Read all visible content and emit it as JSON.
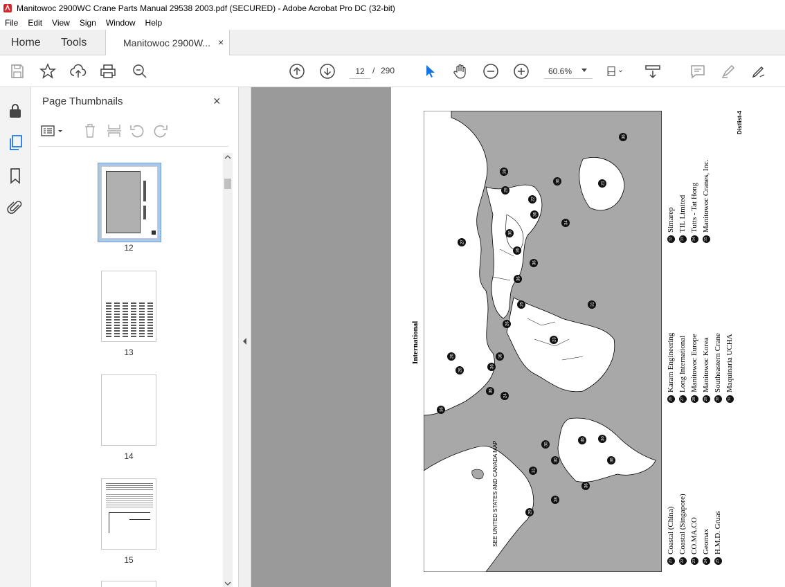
{
  "window": {
    "title": "Manitowoc 2900WC Crane Parts Manual 29538 2003.pdf (SECURED) - Adobe Acrobat Pro DC (32-bit)"
  },
  "menu": [
    "File",
    "Edit",
    "View",
    "Sign",
    "Window",
    "Help"
  ],
  "tabs": {
    "home": "Home",
    "tools": "Tools",
    "doc": "Manitowoc 2900W...",
    "close": "×"
  },
  "toolbar": {
    "page_current": "12",
    "page_sep": "/",
    "page_total": "290",
    "zoom": "60.6%",
    "icons": [
      "save-icon",
      "star-icon",
      "upload-icon",
      "print-icon",
      "search-zoom-icon",
      "prev-page-icon",
      "next-page-icon",
      "select-arrow-icon",
      "hand-icon",
      "zoom-out-icon",
      "zoom-in-icon",
      "fit-page-icon",
      "scroll-mode-icon",
      "comment-icon",
      "highlight-icon",
      "sign-icon"
    ]
  },
  "thumbnails_panel": {
    "title": "Page Thumbnails",
    "close": "×",
    "pages": [
      "12",
      "13",
      "14",
      "15"
    ],
    "selected": "12"
  },
  "document": {
    "heading": "International",
    "corner_label": "Distlist-4",
    "map_note": "SEE UNITED STATES AND CANADA MAP",
    "dealers_col1": [
      {
        "num": "21",
        "name": "Coastal (China)"
      },
      {
        "num": "22",
        "name": "Coastal (Singapore)"
      },
      {
        "num": "23",
        "name": "CO.MA.CO"
      },
      {
        "num": "24",
        "name": "Geomax"
      },
      {
        "num": "25",
        "name": "H.M.D. Gruas"
      }
    ],
    "dealers_col2": [
      {
        "num": "26",
        "name": "Karam Engineering"
      },
      {
        "num": "27",
        "name": "Long International"
      },
      {
        "num": "28",
        "name": "Manitowoc Europe"
      },
      {
        "num": "29",
        "name": "Manitowoc Korea"
      },
      {
        "num": "30",
        "name": "Southeastern Crane"
      },
      {
        "num": "31",
        "name": "Maquinaria UCHA"
      }
    ],
    "dealers_col3": [
      {
        "num": "32",
        "name": "Simarep"
      },
      {
        "num": "33",
        "name": "TIL Limited"
      },
      {
        "num": "34",
        "name": "Tutts - Tat Hong"
      },
      {
        "num": "35",
        "name": "Manitowoc Cranes, Inc."
      }
    ],
    "map_markers": [
      "36",
      "38",
      "29",
      "22",
      "36",
      "21",
      "36",
      "34",
      "36",
      "27",
      "36",
      "36",
      "36",
      "25",
      "31",
      "26",
      "23",
      "26",
      "36",
      "26",
      "36",
      "36",
      "24",
      "36",
      "36",
      "30",
      "30",
      "36",
      "30",
      "31"
    ]
  },
  "colors": {
    "accent": "#1473e6",
    "map_water": "#a8a8a8",
    "viewer_bg": "#9a9a9a"
  }
}
